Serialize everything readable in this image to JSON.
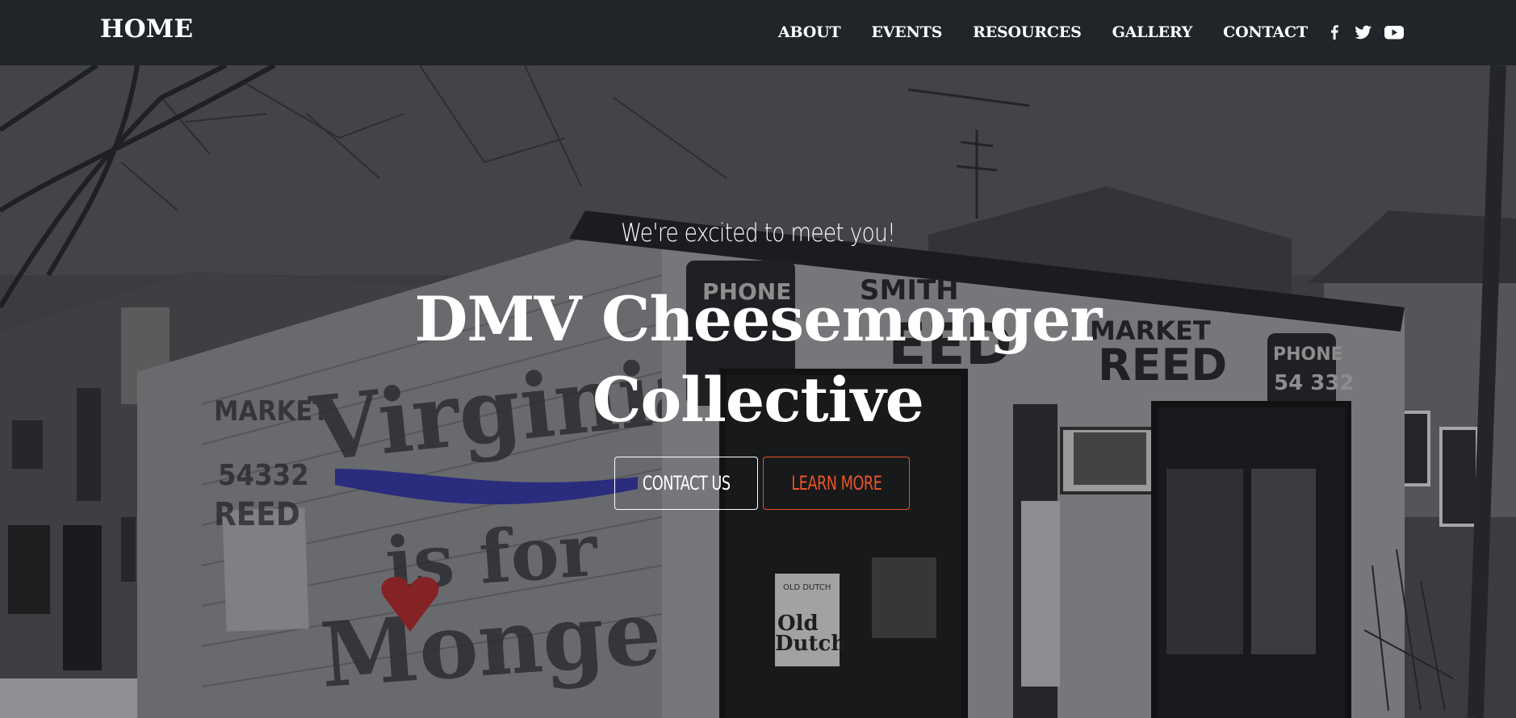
{
  "navbar": {
    "brand": "HOME",
    "links": [
      {
        "label": "ABOUT"
      },
      {
        "label": "EVENTS"
      },
      {
        "label": "RESOURCES"
      },
      {
        "label": "GALLERY"
      },
      {
        "label": "CONTACT"
      }
    ],
    "social_icons": [
      "facebook-icon",
      "twitter-icon",
      "youtube-icon"
    ]
  },
  "hero": {
    "tagline": "We're excited to meet you!",
    "title_line1": "DMV Cheesemonger",
    "title_line2": "Collective",
    "contact_button": "CONTACT US",
    "learn_more_button": "LEARN MORE"
  },
  "colors": {
    "navbar_bg": "#212529",
    "text": "#ffffff",
    "accent": "#e8552a"
  }
}
